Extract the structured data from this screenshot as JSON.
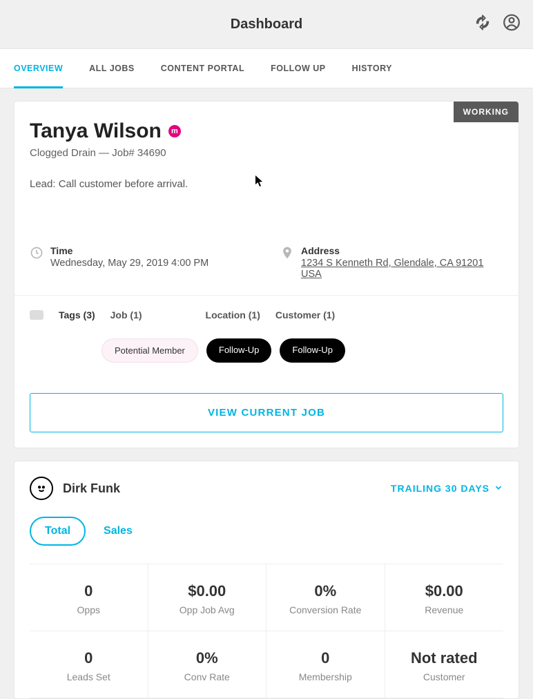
{
  "header": {
    "title": "Dashboard"
  },
  "tabs": {
    "overview": "OVERVIEW",
    "all_jobs": "ALL JOBS",
    "content_portal": "CONTENT PORTAL",
    "follow_up": "FOLLOW UP",
    "history": "HISTORY"
  },
  "job_card": {
    "status": "WORKING",
    "customer_name": "Tanya Wilson",
    "membership_icon_letter": "m",
    "subtitle": "Clogged Drain — Job# 34690",
    "lead_note": "Lead: Call customer before arrival.",
    "time": {
      "label": "Time",
      "value": "Wednesday, May 29, 2019 4:00 PM"
    },
    "address": {
      "label": "Address",
      "value": "1234 S Kenneth Rd, Glendale, CA 91201 USA"
    },
    "tags": {
      "count_label": "Tags (3)",
      "categories": {
        "job": "Job (1)",
        "location": "Location (1)",
        "customer": "Customer (1)"
      },
      "chips": [
        {
          "label": "Potential Member",
          "style": "pink"
        },
        {
          "label": "Follow-Up",
          "style": "black"
        },
        {
          "label": "Follow-Up",
          "style": "black"
        }
      ]
    },
    "view_job_label": "VIEW CURRENT JOB"
  },
  "stats_card": {
    "user_name": "Dirk Funk",
    "trailing_label": "TRAILING 30 DAYS",
    "segments": {
      "total": "Total",
      "sales": "Sales"
    },
    "stats": [
      {
        "value": "0",
        "label": "Opps"
      },
      {
        "value": "$0.00",
        "label": "Opp Job Avg"
      },
      {
        "value": "0%",
        "label": "Conversion Rate"
      },
      {
        "value": "$0.00",
        "label": "Revenue"
      },
      {
        "value": "0",
        "label": "Leads Set"
      },
      {
        "value": "0%",
        "label": "Conv Rate"
      },
      {
        "value": "0",
        "label": "Membership"
      },
      {
        "value": "Not rated",
        "label": "Customer"
      }
    ]
  }
}
